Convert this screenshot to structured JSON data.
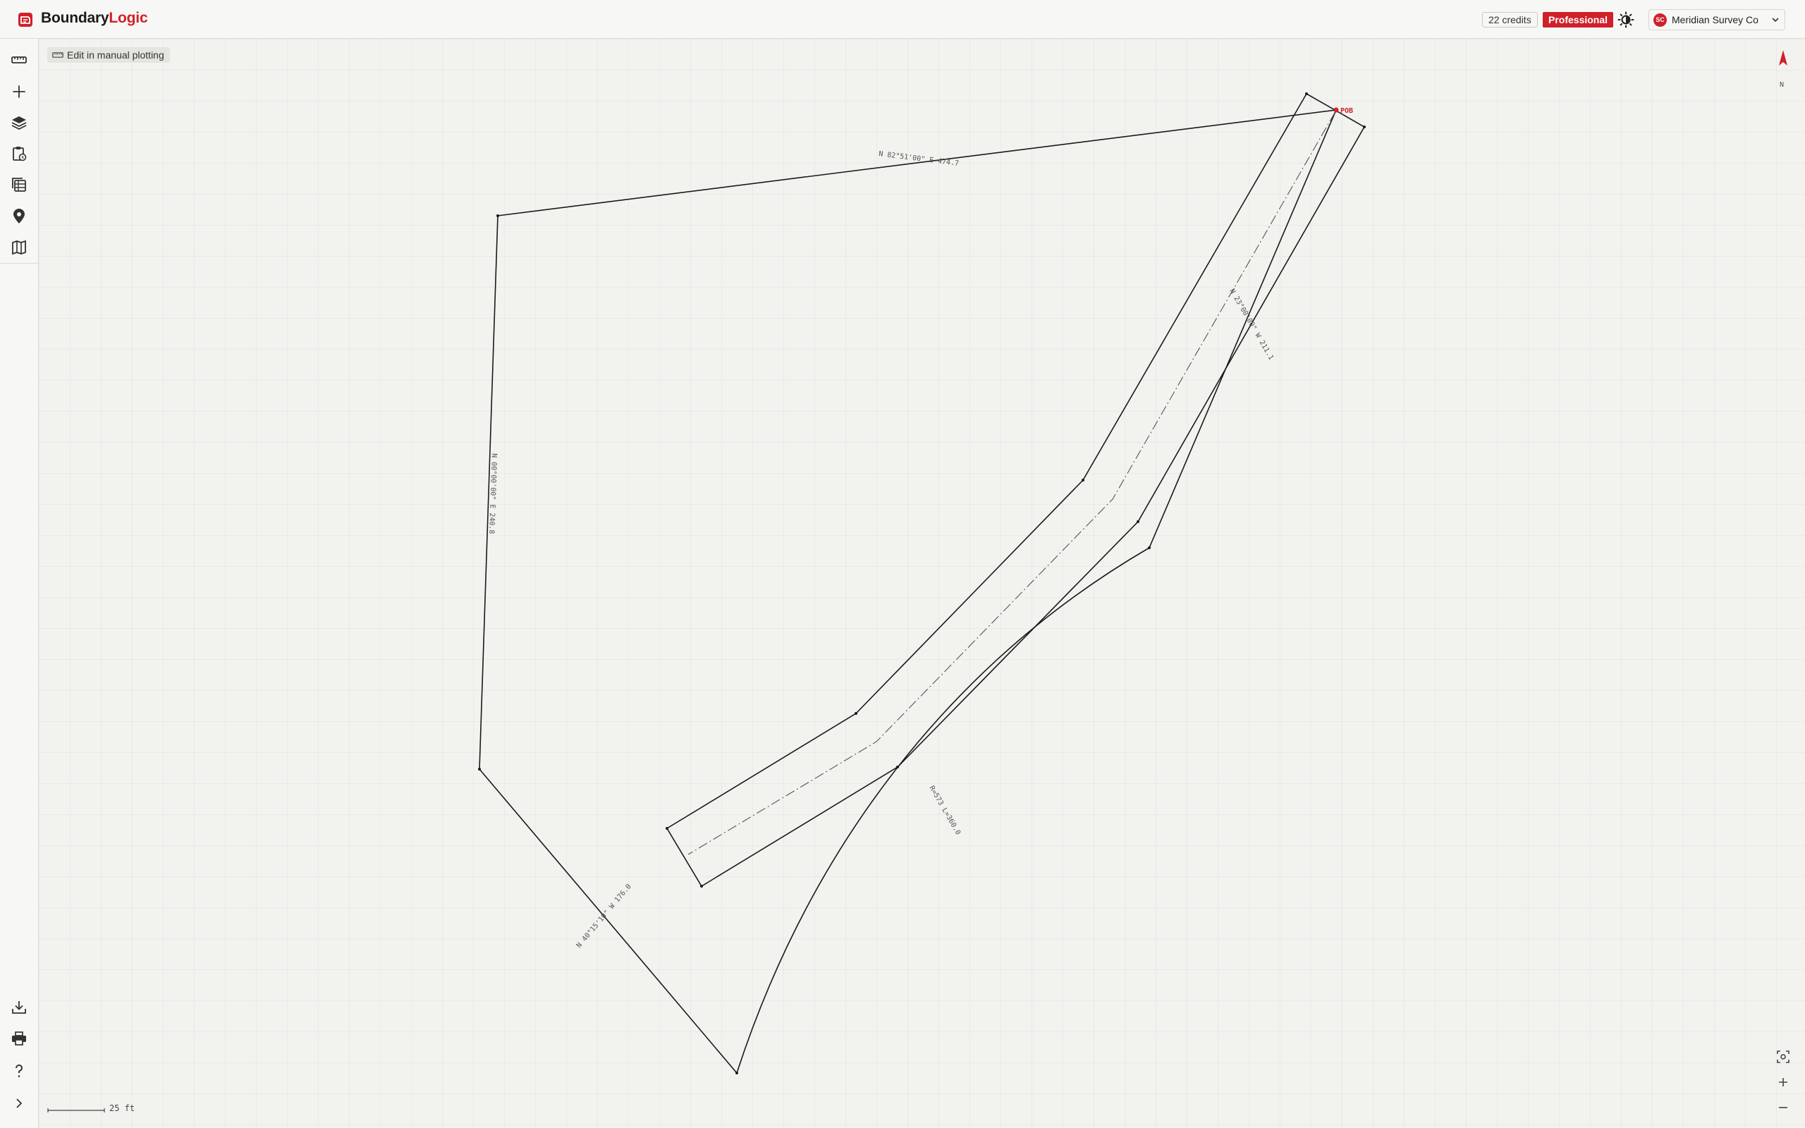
{
  "brand": {
    "part1": "Boundary",
    "part2": "Logic"
  },
  "header": {
    "credits": "22 credits",
    "plan": "Professional",
    "org_initials": "SC",
    "org_name": "Meridian Survey Co"
  },
  "map": {
    "edit_button": "Edit in manual plotting",
    "north": "N",
    "scale": "25 ft",
    "pob": "POB",
    "calls": {
      "top": "N 82°51'00\" E 474.7",
      "left": "N 00°00'00\" E 240.8",
      "southwest": "N 40°15'10\" W 176.0",
      "arc": "R=573 L=360.0",
      "east": "N 23°00'00\" W 211.1"
    }
  },
  "colors": {
    "accent": "#d0202a",
    "line": "#1a1a1a"
  }
}
